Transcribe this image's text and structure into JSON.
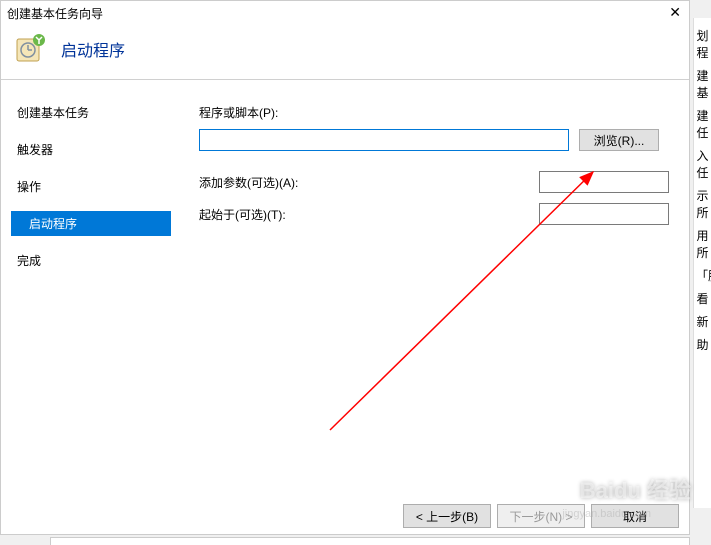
{
  "dialog": {
    "title": "创建基本任务向导",
    "close": "✕"
  },
  "header": {
    "title": "启动程序"
  },
  "sidebar": {
    "items": [
      {
        "label": "创建基本任务",
        "active": false,
        "sub": false
      },
      {
        "label": "触发器",
        "active": false,
        "sub": false
      },
      {
        "label": "操作",
        "active": false,
        "sub": false
      },
      {
        "label": "启动程序",
        "active": true,
        "sub": true
      },
      {
        "label": "完成",
        "active": false,
        "sub": false
      }
    ]
  },
  "form": {
    "program_label": "程序或脚本(P):",
    "program_value": "",
    "browse_label": "浏览(R)...",
    "args_label": "添加参数(可选)(A):",
    "args_value": "",
    "startin_label": "起始于(可选)(T):",
    "startin_value": ""
  },
  "footer": {
    "back": "< 上一步(B)",
    "next": "下一步(N) >",
    "cancel": "取消"
  },
  "right_strip": [
    "划程",
    "建基",
    "建任",
    "入任",
    "示所",
    "用所",
    "「服",
    "看",
    "新",
    "助"
  ],
  "watermark": "Baidu 经验",
  "watermark_sub": "jingyan.baidu.com"
}
